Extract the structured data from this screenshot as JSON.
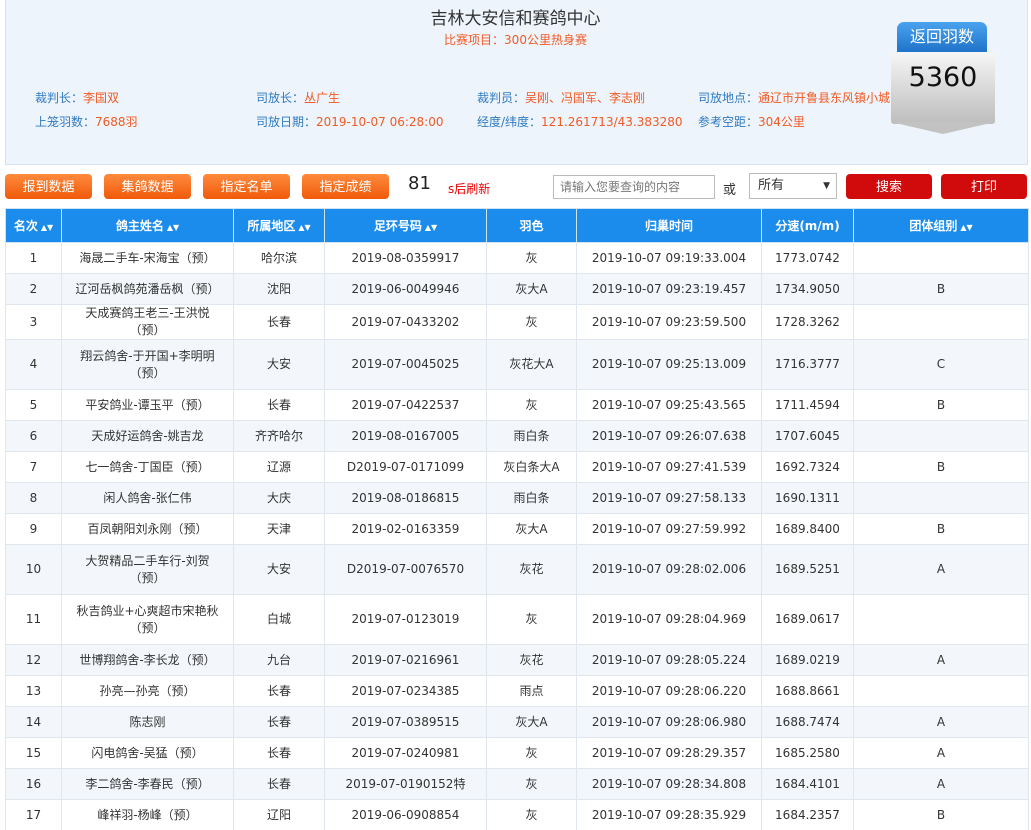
{
  "header": {
    "title": "吉林大安信和赛鸽中心",
    "subtitle": "比赛项目：300公里热身赛",
    "info": {
      "chief_referee_label": "裁判长：",
      "chief_referee": "李国双",
      "release_chief_label": "司放长：",
      "release_chief": "丛广生",
      "referees_label": "裁判员：",
      "referees": "吴刚、冯国军、李志刚",
      "release_site_label": "司放地点：",
      "release_site": "通辽市开鲁县东风镇小城",
      "entries_label": "上笼羽数：",
      "entries": "7688羽",
      "release_date_label": "司放日期：",
      "release_date": "2019-10-07 06:28:00",
      "coords_label": "经度/纬度：",
      "coords": "121.261713/43.383280",
      "distance_label": "参考空距：",
      "distance": "304公里"
    },
    "badge": {
      "label": "返回羽数",
      "value": "5360"
    }
  },
  "toolbar": {
    "buttons": [
      "报到数据",
      "集鸽数据",
      "指定名单",
      "指定成绩"
    ],
    "refresh_count": "81",
    "refresh_text": "s后刷新",
    "search_placeholder": "请输入您要查询的内容",
    "or_label": "或",
    "select_value": "所有",
    "search_button": "搜索",
    "print_button": "打印"
  },
  "table": {
    "headers": [
      "名次",
      "鸽主姓名",
      "所属地区",
      "足环号码",
      "羽色",
      "归巢时间",
      "分速(m/m)",
      "团体组别"
    ],
    "rows": [
      [
        "1",
        "海晟二手车-宋海宝（预）",
        "哈尔滨",
        "2019-08-0359917",
        "灰",
        "2019-10-07 09:19:33.004",
        "1773.0742",
        ""
      ],
      [
        "2",
        "辽河岳枫鸽苑潘岳枫（预）",
        "沈阳",
        "2019-06-0049946",
        "灰大A",
        "2019-10-07 09:23:19.457",
        "1734.9050",
        "B"
      ],
      [
        "3",
        "天成赛鸽王老三-王洪悦（预）",
        "长春",
        "2019-07-0433202",
        "灰",
        "2019-10-07 09:23:59.500",
        "1728.3262",
        ""
      ],
      [
        "4",
        "翔云鸽舍-于开国+李明明（预）",
        "大安",
        "2019-07-0045025",
        "灰花大A",
        "2019-10-07 09:25:13.009",
        "1716.3777",
        "C"
      ],
      [
        "5",
        "平安鸽业-谭玉平（预）",
        "长春",
        "2019-07-0422537",
        "灰",
        "2019-10-07 09:25:43.565",
        "1711.4594",
        "B"
      ],
      [
        "6",
        "天成好运鸽舍-姚吉龙",
        "齐齐哈尔",
        "2019-08-0167005",
        "雨白条",
        "2019-10-07 09:26:07.638",
        "1707.6045",
        ""
      ],
      [
        "7",
        "七一鸽舍-丁国臣（预）",
        "辽源",
        "D2019-07-0171099",
        "灰白条大A",
        "2019-10-07 09:27:41.539",
        "1692.7324",
        "B"
      ],
      [
        "8",
        "闲人鸽舍-张仁伟",
        "大庆",
        "2019-08-0186815",
        "雨白条",
        "2019-10-07 09:27:58.133",
        "1690.1311",
        ""
      ],
      [
        "9",
        "百凤朝阳刘永刚（预）",
        "天津",
        "2019-02-0163359",
        "灰大A",
        "2019-10-07 09:27:59.992",
        "1689.8400",
        "B"
      ],
      [
        "10",
        "大贺精品二手车行-刘贺（预）",
        "大安",
        "D2019-07-0076570",
        "灰花",
        "2019-10-07 09:28:02.006",
        "1689.5251",
        "A"
      ],
      [
        "11",
        "秋吉鸽业+心爽超市宋艳秋（预）",
        "白城",
        "2019-07-0123019",
        "灰",
        "2019-10-07 09:28:04.969",
        "1689.0617",
        ""
      ],
      [
        "12",
        "世博翔鸽舍-李长龙（预）",
        "九台",
        "2019-07-0216961",
        "灰花",
        "2019-10-07 09:28:05.224",
        "1689.0219",
        "A"
      ],
      [
        "13",
        "孙亮—孙亮（预）",
        "长春",
        "2019-07-0234385",
        "雨点",
        "2019-10-07 09:28:06.220",
        "1688.8661",
        ""
      ],
      [
        "14",
        "陈志刚",
        "长春",
        "2019-07-0389515",
        "灰大A",
        "2019-10-07 09:28:06.980",
        "1688.7474",
        "A"
      ],
      [
        "15",
        "闪电鸽舍-吴猛（预）",
        "长春",
        "2019-07-0240981",
        "灰",
        "2019-10-07 09:28:29.357",
        "1685.2580",
        "A"
      ],
      [
        "16",
        "李二鸽舍-李春民（预）",
        "长春",
        "2019-07-0190152特",
        "灰",
        "2019-10-07 09:28:34.808",
        "1684.4101",
        "A"
      ],
      [
        "17",
        "峰祥羽-杨峰（预）",
        "辽阳",
        "2019-06-0908854",
        "灰",
        "2019-10-07 09:28:35.929",
        "1684.2357",
        "B"
      ]
    ]
  },
  "colors": {
    "accent": "#1b8ceb",
    "orange": "#f05a0a",
    "red": "#d10b0b",
    "info_label": "#2f7ac2",
    "info_value": "#f15a24"
  }
}
